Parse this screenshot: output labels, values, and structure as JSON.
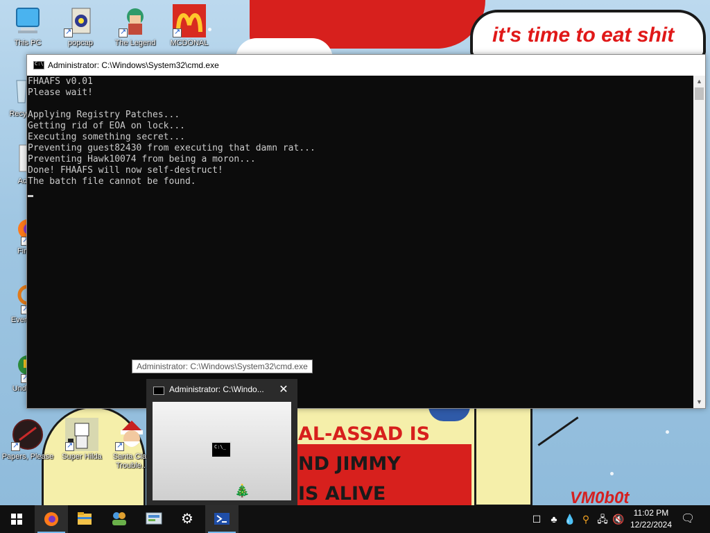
{
  "wallpaper": {
    "speech_text": "it's time to eat shit",
    "sign_lines": [
      "AL-ASSAD IS",
      "ND JIMMY",
      "IS ALIVE"
    ],
    "watermark": "VM0b0t"
  },
  "desktop_icons": [
    {
      "label": "This PC",
      "icon": "computer-icon"
    },
    {
      "label": "popcap",
      "icon": "folder-icon"
    },
    {
      "label": "The Legend",
      "icon": "game-character-icon"
    },
    {
      "label": "MCDONAL",
      "icon": "mcdonalds-logo-icon"
    },
    {
      "label": "Recyc",
      "icon": "recycle-bin-icon"
    },
    {
      "label": "Acti",
      "icon": "document-icon"
    },
    {
      "label": "Fire",
      "icon": "firefox-icon"
    },
    {
      "label": "Every",
      "icon": "search-app-icon"
    },
    {
      "label": "Unde",
      "icon": "game-icon"
    },
    {
      "label": "Papers, Please",
      "icon": "papers-please-icon"
    },
    {
      "label": "Super Hilda",
      "icon": "pixel-game-icon"
    },
    {
      "label": "Santa Clau Trouble...",
      "icon": "santa-icon"
    }
  ],
  "cmd": {
    "title": "Administrator: C:\\Windows\\System32\\cmd.exe",
    "lines": [
      "FHAAFS v0.01",
      "Please wait!",
      "",
      "Applying Registry Patches...",
      "Getting rid of EOA on lock...",
      "Executing something secret...",
      "Preventing guest82430 from executing that damn rat...",
      "Preventing Hawk10074 from being a moron...",
      "Done! FHAAFS will now self-destruct!",
      "The batch file cannot be found."
    ]
  },
  "tooltip": "Administrator: C:\\Windows\\System32\\cmd.exe",
  "thumbnail": {
    "title": "Administrator: C:\\Windo...",
    "close_glyph": "✕"
  },
  "taskbar": {
    "apps": [
      {
        "name": "firefox",
        "icon": "firefox-icon",
        "active": true
      },
      {
        "name": "file-explorer",
        "icon": "folder-icon",
        "active": false
      },
      {
        "name": "app-3",
        "icon": "people-icon",
        "active": false
      },
      {
        "name": "app-4",
        "icon": "control-panel-icon",
        "active": false
      },
      {
        "name": "settings",
        "icon": "gear-icon",
        "active": false
      },
      {
        "name": "powershell",
        "icon": "powershell-icon",
        "active": true
      }
    ],
    "clock_time": "11:02 PM",
    "clock_date": "12/22/2024"
  },
  "colors": {
    "console_bg": "#0c0c0c",
    "console_text": "#cccccc",
    "taskbar_bg": "#101010",
    "accent": "#76b9ed",
    "speech_red": "#e01818"
  }
}
